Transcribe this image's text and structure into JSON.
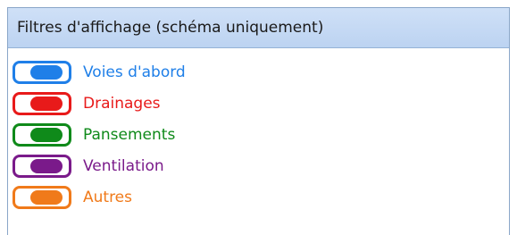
{
  "panel": {
    "title": "Filtres d'affichage (schéma uniquement)"
  },
  "filters": [
    {
      "label": "Voies d'abord",
      "color": "#1f7fe8",
      "checked": true
    },
    {
      "label": "Drainages",
      "color": "#e81a1a",
      "checked": true
    },
    {
      "label": "Pansements",
      "color": "#0f8a1a",
      "checked": true
    },
    {
      "label": "Ventilation",
      "color": "#7a1a8a",
      "checked": true
    },
    {
      "label": "Autres",
      "color": "#f07a1a",
      "checked": true
    }
  ]
}
